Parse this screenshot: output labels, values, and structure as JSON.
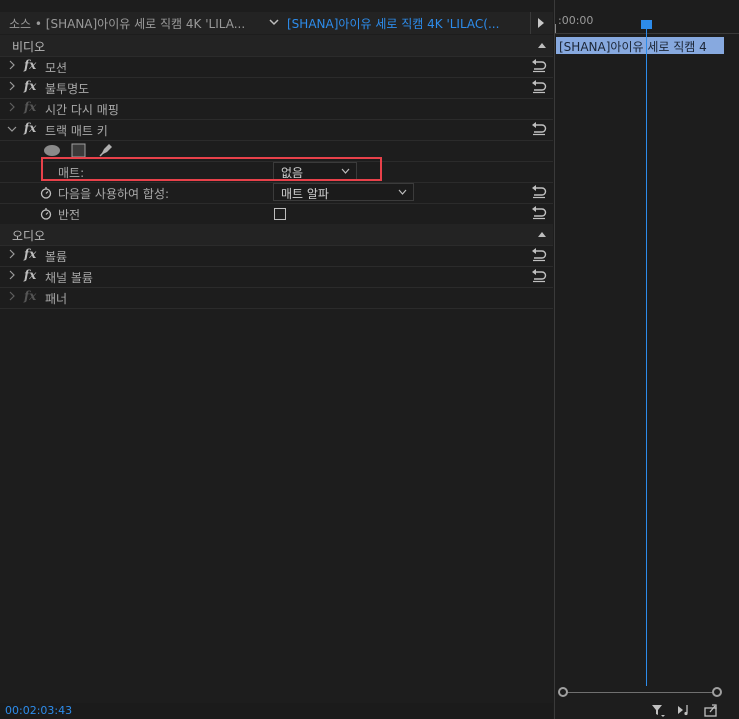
{
  "header": {
    "source_tab": "소스 • [SHANA]아이유 세로 직캠 4K 'LILA...",
    "clip_tab": "[SHANA]아이유 세로 직캠 4K 'LILAC(..."
  },
  "sections": {
    "video": "비디오",
    "audio": "오디오"
  },
  "effects": {
    "motion": "모션",
    "opacity": "불투명도",
    "time_remap": "시간 다시 매핑",
    "track_matte": "트랙 매트 키",
    "volume": "볼륨",
    "channel_volume": "채널 볼륨",
    "panner": "패너"
  },
  "fx_label": "fx",
  "track_matte_props": {
    "matte_label": "매트:",
    "matte_value": "없음",
    "composite_label": "다음을 사용하여 합성:",
    "composite_value": "매트 알파",
    "reverse_label": "반전",
    "reverse_checked": false
  },
  "timeline": {
    "ruler_time": ":00:00",
    "clip_name": "[SHANA]아이유 세로 직캠 4"
  },
  "footer": {
    "timecode": "00:02:03:43"
  },
  "colors": {
    "accent": "#2d8ceb",
    "highlight": "#e8414a",
    "clip": "#87a9df"
  }
}
